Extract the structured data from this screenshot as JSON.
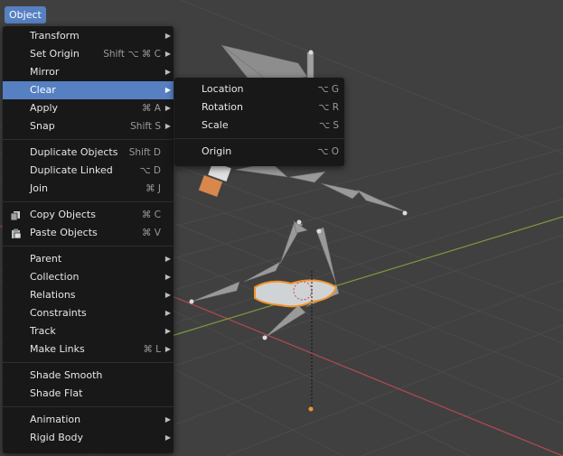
{
  "header": {
    "menu_button": "Object"
  },
  "object_menu": {
    "groups": [
      [
        {
          "label": "Transform",
          "shortcut": "",
          "submenu": true
        },
        {
          "label": "Set Origin",
          "shortcut": "Shift ⌥ ⌘ C",
          "submenu": true
        },
        {
          "label": "Mirror",
          "shortcut": "",
          "submenu": true
        },
        {
          "label": "Clear",
          "shortcut": "",
          "submenu": true,
          "active": true
        },
        {
          "label": "Apply",
          "shortcut": "⌘ A",
          "submenu": true
        },
        {
          "label": "Snap",
          "shortcut": "Shift S",
          "submenu": true
        }
      ],
      [
        {
          "label": "Duplicate Objects",
          "shortcut": "Shift D",
          "submenu": false
        },
        {
          "label": "Duplicate Linked",
          "shortcut": "⌥ D",
          "submenu": false
        },
        {
          "label": "Join",
          "shortcut": "⌘ J",
          "submenu": false
        }
      ],
      [
        {
          "label": "Copy Objects",
          "shortcut": "⌘ C",
          "submenu": false,
          "icon": "copy-icon"
        },
        {
          "label": "Paste Objects",
          "shortcut": "⌘ V",
          "submenu": false,
          "icon": "paste-icon"
        }
      ],
      [
        {
          "label": "Parent",
          "shortcut": "",
          "submenu": true
        },
        {
          "label": "Collection",
          "shortcut": "",
          "submenu": true
        },
        {
          "label": "Relations",
          "shortcut": "",
          "submenu": true
        },
        {
          "label": "Constraints",
          "shortcut": "",
          "submenu": true
        },
        {
          "label": "Track",
          "shortcut": "",
          "submenu": true
        },
        {
          "label": "Make Links",
          "shortcut": "⌘ L",
          "submenu": true
        }
      ],
      [
        {
          "label": "Shade Smooth",
          "shortcut": "",
          "submenu": false
        },
        {
          "label": "Shade Flat",
          "shortcut": "",
          "submenu": false
        }
      ],
      [
        {
          "label": "Animation",
          "shortcut": "",
          "submenu": true
        },
        {
          "label": "Rigid Body",
          "shortcut": "",
          "submenu": true
        }
      ]
    ]
  },
  "clear_submenu": {
    "groups": [
      [
        {
          "label": "Location",
          "shortcut": "⌥ G"
        },
        {
          "label": "Rotation",
          "shortcut": "⌥ R"
        },
        {
          "label": "Scale",
          "shortcut": "⌥ S"
        }
      ],
      [
        {
          "label": "Origin",
          "shortcut": "⌥ O"
        }
      ]
    ]
  },
  "icons": {
    "submenu_arrow": "submenu-arrow-icon"
  },
  "colors": {
    "accent": "#5680c2",
    "menu_bg": "#181818",
    "viewport_bg": "#3f3f3f",
    "x_axis": "#b34a52",
    "y_axis": "#7e9a3e",
    "selection_outline": "#f0932b"
  }
}
